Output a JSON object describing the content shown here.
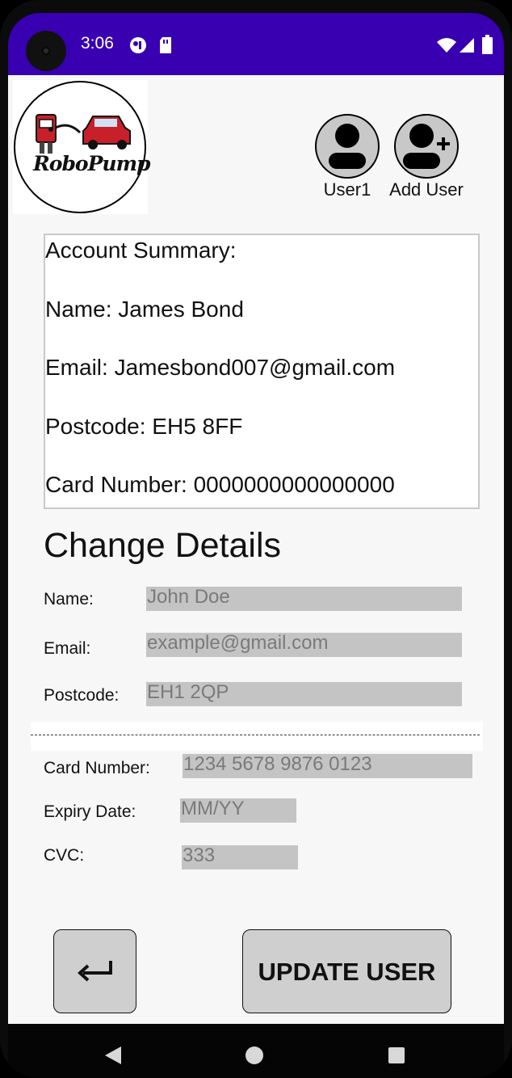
{
  "status_bar": {
    "time": "3:06",
    "icons": [
      "camera-lens-icon",
      "vpn-key-icon",
      "sd-card-icon",
      "wifi-icon",
      "signal-icon",
      "battery-icon"
    ]
  },
  "header": {
    "logo_text": "RoboPump",
    "user_button_label": "User1",
    "add_user_label": "Add User"
  },
  "account_summary": {
    "heading": "Account Summary:",
    "name": "Name: James Bond",
    "email": "Email: Jamesbond007@gmail.com",
    "postcode": "Postcode: EH5 8FF",
    "card_number": "Card Number: 0000000000000000"
  },
  "change_details": {
    "title": "Change Details",
    "name_label": "Name:",
    "name_placeholder": "John Doe",
    "email_label": "Email:",
    "email_placeholder": "example@gmail.com",
    "postcode_label": "Postcode:",
    "postcode_placeholder": "EH1 2QP",
    "separator": "--------------------------------------------------------------------------------",
    "card_label": "Card Number:",
    "card_placeholder": "1234 5678 9876 0123",
    "expiry_label": "Expiry Date:",
    "expiry_placeholder": "MM/YY",
    "cvc_label": "CVC:",
    "cvc_placeholder": "333"
  },
  "actions": {
    "back_icon": "return-arrow-icon",
    "update_label": "UPDATE USER"
  },
  "colors": {
    "status_bar": "#3800b0",
    "input_fill": "#c4c4c4",
    "button_fill": "#cfcfcf",
    "avatar_fill": "#c8c8c8"
  }
}
